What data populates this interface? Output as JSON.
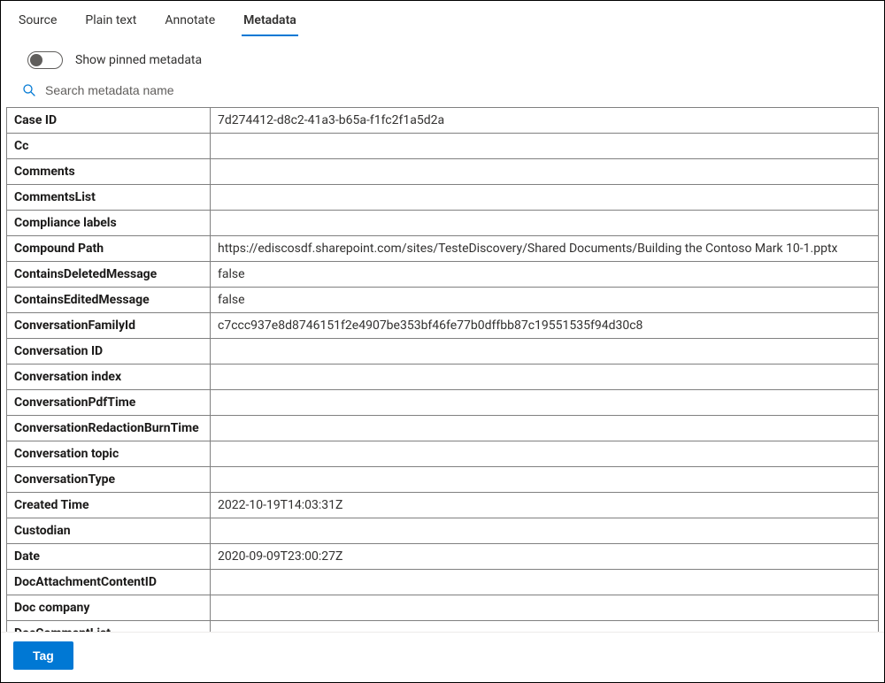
{
  "tabs": [
    {
      "label": "Source",
      "active": false
    },
    {
      "label": "Plain text",
      "active": false
    },
    {
      "label": "Annotate",
      "active": false
    },
    {
      "label": "Metadata",
      "active": true
    }
  ],
  "toggle": {
    "label": "Show pinned metadata",
    "on": false
  },
  "search": {
    "placeholder": "Search metadata name"
  },
  "footer": {
    "tag_button": "Tag"
  },
  "metadata_rows": [
    {
      "key": "Case ID",
      "value": "7d274412-d8c2-41a3-b65a-f1fc2f1a5d2a"
    },
    {
      "key": "Cc",
      "value": ""
    },
    {
      "key": "Comments",
      "value": ""
    },
    {
      "key": "CommentsList",
      "value": ""
    },
    {
      "key": "Compliance labels",
      "value": ""
    },
    {
      "key": "Compound Path",
      "value": "https://ediscosdf.sharepoint.com/sites/TesteDiscovery/Shared Documents/Building the Contoso Mark 10-1.pptx"
    },
    {
      "key": "ContainsDeletedMessage",
      "value": "false"
    },
    {
      "key": "ContainsEditedMessage",
      "value": "false"
    },
    {
      "key": "ConversationFamilyId",
      "value": "c7ccc937e8d8746151f2e4907be353bf46fe77b0dffbb87c19551535f94d30c8"
    },
    {
      "key": "Conversation ID",
      "value": ""
    },
    {
      "key": "Conversation index",
      "value": ""
    },
    {
      "key": "ConversationPdfTime",
      "value": ""
    },
    {
      "key": "ConversationRedactionBurnTime",
      "value": ""
    },
    {
      "key": "Conversation topic",
      "value": ""
    },
    {
      "key": "ConversationType",
      "value": ""
    },
    {
      "key": "Created Time",
      "value": "2022-10-19T14:03:31Z"
    },
    {
      "key": "Custodian",
      "value": ""
    },
    {
      "key": "Date",
      "value": "2020-09-09T23:00:27Z"
    },
    {
      "key": "DocAttachmentContentID",
      "value": ""
    },
    {
      "key": "Doc company",
      "value": ""
    },
    {
      "key": "DocCommentList",
      "value": ""
    }
  ]
}
